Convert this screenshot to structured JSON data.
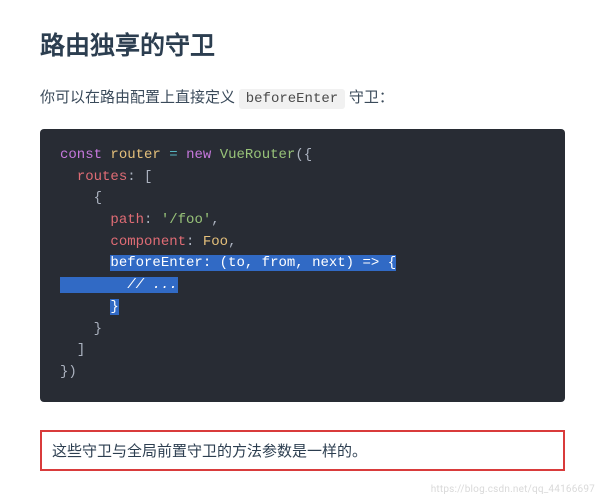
{
  "heading": "路由独享的守卫",
  "intro": {
    "before": "你可以在路由配置上直接定义 ",
    "code": "beforeEnter",
    "after": " 守卫："
  },
  "code": {
    "l1": {
      "const": "const",
      "name": "router",
      "eq": "=",
      "new": "new",
      "cls": "VueRouter",
      "open": "({"
    },
    "l2": {
      "key": "routes",
      "colon": ":",
      "open": "["
    },
    "l3": {
      "open": "{"
    },
    "l4": {
      "key": "path",
      "colon": ":",
      "val": "'/foo'",
      "comma": ","
    },
    "l5": {
      "key": "component",
      "colon": ":",
      "val": "Foo",
      "comma": ","
    },
    "l6": {
      "key": "beforeEnter",
      "colon": ":",
      "args": "(to, from, next)",
      "arrow": "=>",
      "open": "{"
    },
    "l7": {
      "cmt": "// ..."
    },
    "l8": {
      "close": "}"
    },
    "l9": {
      "close": "}"
    },
    "l10": {
      "close": "]"
    },
    "l11": {
      "close": "})"
    }
  },
  "note": "这些守卫与全局前置守卫的方法参数是一样的。",
  "watermark": "https://blog.csdn.net/qq_44166697"
}
